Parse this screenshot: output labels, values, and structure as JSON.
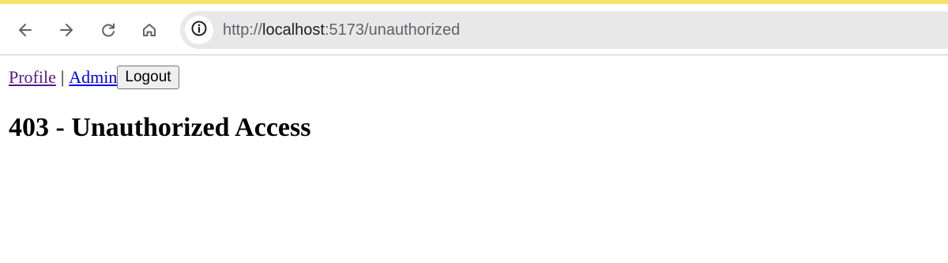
{
  "browser": {
    "url_scheme": "http://",
    "url_host": "localhost",
    "url_rest": ":5173/unauthorized",
    "icons": {
      "back": "arrow-left-icon",
      "forward": "arrow-right-icon",
      "reload": "reload-icon",
      "home": "home-icon",
      "site_info": "info-icon"
    },
    "accent_color": "#f7e16a"
  },
  "page": {
    "nav": {
      "profile_label": "Profile",
      "separator": "|",
      "admin_label": "Admin",
      "logout_label": "Logout"
    },
    "heading": "403 - Unauthorized Access"
  }
}
